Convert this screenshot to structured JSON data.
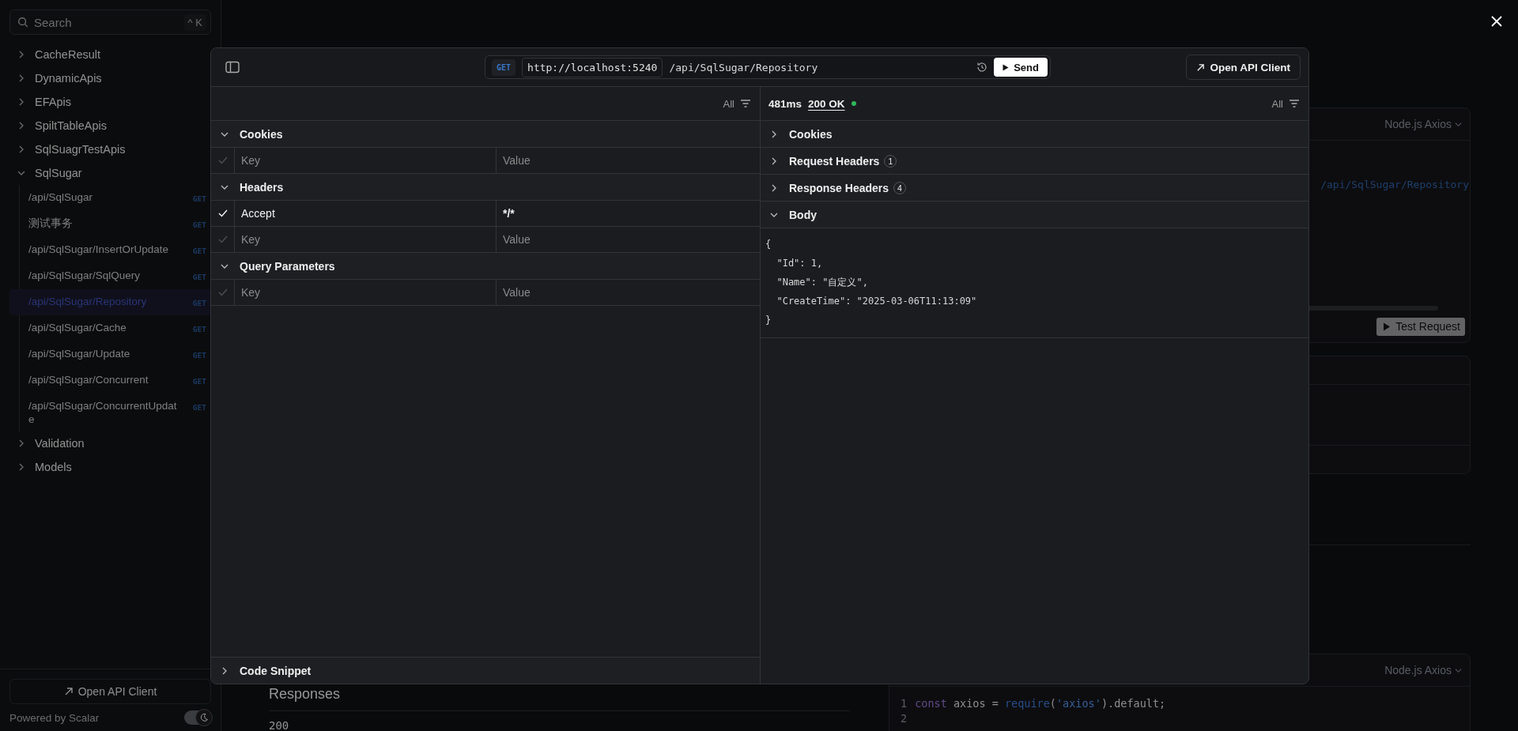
{
  "sidebar": {
    "search": {
      "placeholder": "Search",
      "shortcut": "^ K"
    },
    "groups": [
      {
        "label": "CacheResult",
        "expanded": false
      },
      {
        "label": "DynamicApis",
        "expanded": false
      },
      {
        "label": "EFApis",
        "expanded": false
      },
      {
        "label": "SpiltTableApis",
        "expanded": false
      },
      {
        "label": "SqlSuagrTestApis",
        "expanded": false
      },
      {
        "label": "SqlSugar",
        "expanded": true,
        "children": [
          {
            "label": "/api/SqlSugar",
            "method": "GET",
            "selected": false
          },
          {
            "label": "测试事务",
            "method": "GET",
            "selected": false
          },
          {
            "label": "/api/SqlSugar/InsertOrUpdate",
            "method": "GET",
            "selected": false
          },
          {
            "label": "/api/SqlSugar/SqlQuery",
            "method": "GET",
            "selected": false
          },
          {
            "label": "/api/SqlSugar/Repository",
            "method": "GET",
            "selected": true
          },
          {
            "label": "/api/SqlSugar/Cache",
            "method": "GET",
            "selected": false
          },
          {
            "label": "/api/SqlSugar/Update",
            "method": "GET",
            "selected": false
          },
          {
            "label": "/api/SqlSugar/Concurrent",
            "method": "GET",
            "selected": false
          },
          {
            "label": "/api/SqlSugar/ConcurrentUpdate",
            "method": "GET",
            "selected": false
          }
        ]
      },
      {
        "label": "Validation",
        "expanded": false
      },
      {
        "label": "Models",
        "expanded": false
      }
    ],
    "footer_button": "Open API Client",
    "powered_by": "Powered by Scalar",
    "dark_mode": true
  },
  "background": {
    "code_card": {
      "language": "Node.js Axios",
      "url_fragment": "/api/SqlSugar/Repository",
      "test_button": "Test Request"
    },
    "responses_heading": "Responses",
    "status_code": "200",
    "code_card_2": {
      "language": "Node.js Axios",
      "lines": [
        {
          "number": "1",
          "tokens": [
            {
              "text": "const",
              "kind": "keyword"
            },
            {
              "text": " axios = ",
              "kind": "plain"
            },
            {
              "text": "require",
              "kind": "function"
            },
            {
              "text": "(",
              "kind": "plain"
            },
            {
              "text": "'axios'",
              "kind": "string"
            },
            {
              "text": ").default;",
              "kind": "plain"
            }
          ]
        },
        {
          "number": "2"
        }
      ]
    }
  },
  "modal": {
    "method": "GET",
    "base_url": "http://localhost:5240",
    "path": "/api/SqlSugar/Repository",
    "send": "Send",
    "open_client": "Open API Client",
    "request": {
      "filter": "All",
      "sections": [
        {
          "title": "Cookies",
          "expanded": true,
          "rows": [
            {
              "checked": false,
              "key_placeholder": "Key",
              "value_placeholder": "Value"
            }
          ]
        },
        {
          "title": "Headers",
          "expanded": true,
          "rows": [
            {
              "checked": true,
              "key": "Accept",
              "value": "*/*"
            },
            {
              "checked": false,
              "key_placeholder": "Key",
              "value_placeholder": "Value"
            }
          ]
        },
        {
          "title": "Query Parameters",
          "expanded": true,
          "rows": [
            {
              "checked": false,
              "key_placeholder": "Key",
              "value_placeholder": "Value"
            }
          ]
        }
      ],
      "code_snippet": {
        "title": "Code Snippet",
        "expanded": false
      }
    },
    "response": {
      "time": "481ms",
      "status": "200 OK",
      "filter": "All",
      "sections": [
        {
          "title": "Cookies",
          "expanded": false
        },
        {
          "title": "Request Headers",
          "count": "1",
          "expanded": false
        },
        {
          "title": "Response Headers",
          "count": "4",
          "expanded": false
        },
        {
          "title": "Body",
          "expanded": true,
          "body_lines": [
            "{",
            "  \"Id\": 1,",
            "  \"Name\": \"自定义\",",
            "  \"CreateTime\": \"2025-03-06T11:13:09\"",
            "}"
          ]
        }
      ]
    }
  }
}
